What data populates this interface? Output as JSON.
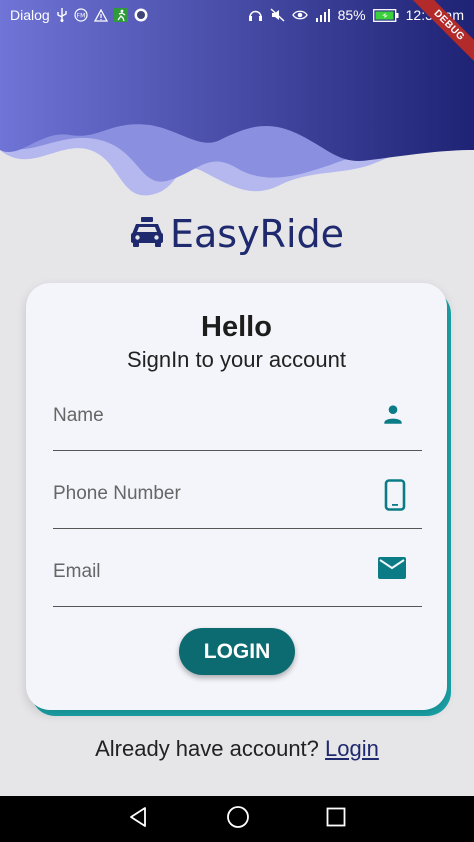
{
  "status_bar": {
    "carrier": "Dialog",
    "battery_percent": "85%",
    "time": "12:39 am",
    "left_icons": [
      "usb-icon",
      "fm-radio-icon",
      "warning-icon",
      "running-app-icon",
      "github-icon"
    ],
    "right_icons": [
      "headphones-icon",
      "mute-icon",
      "eye-icon",
      "signal-icon",
      "battery-icon"
    ]
  },
  "debug_banner": "DEBUG",
  "brand": {
    "icon": "taxi-icon",
    "title": "EasyRide"
  },
  "card": {
    "title": "Hello",
    "subtitle": "SignIn to your account",
    "fields": {
      "name": {
        "placeholder": "Name",
        "value": "",
        "icon": "person-icon"
      },
      "phone": {
        "placeholder": "Phone Number",
        "value": "",
        "icon": "phone-icon"
      },
      "email": {
        "placeholder": "Email",
        "value": "",
        "icon": "mail-icon"
      }
    },
    "login_label": "LOGIN"
  },
  "footer": {
    "prompt": "Already have account?",
    "link_label": "Login"
  },
  "colors": {
    "brand": "#1f2a6e",
    "accent": "#0b6b70",
    "card_shadow": "#1aa3a8",
    "header_gradient_start": "#6f74d6",
    "header_gradient_end": "#1f2375"
  },
  "nav_bar": {
    "icons": [
      "back-icon",
      "home-icon",
      "recents-icon"
    ]
  }
}
